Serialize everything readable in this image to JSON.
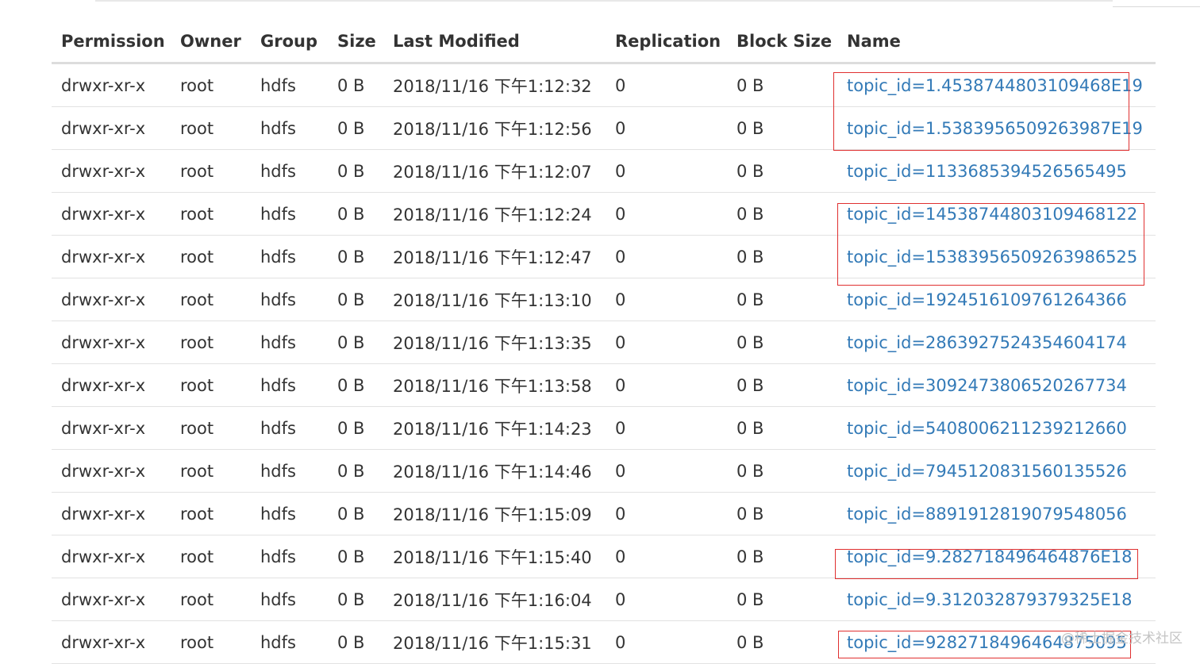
{
  "table": {
    "headers": [
      "Permission",
      "Owner",
      "Group",
      "Size",
      "Last Modified",
      "Replication",
      "Block Size",
      "Name"
    ],
    "rows": [
      {
        "permission": "drwxr-xr-x",
        "owner": "root",
        "group": "hdfs",
        "size": "0 B",
        "modified": "2018/11/16 下午1:12:32",
        "replication": "0",
        "block_size": "0 B",
        "name": "topic_id=1.4538744803109468E19"
      },
      {
        "permission": "drwxr-xr-x",
        "owner": "root",
        "group": "hdfs",
        "size": "0 B",
        "modified": "2018/11/16 下午1:12:56",
        "replication": "0",
        "block_size": "0 B",
        "name": "topic_id=1.5383956509263987E19"
      },
      {
        "permission": "drwxr-xr-x",
        "owner": "root",
        "group": "hdfs",
        "size": "0 B",
        "modified": "2018/11/16 下午1:12:07",
        "replication": "0",
        "block_size": "0 B",
        "name": "topic_id=1133685394526565495"
      },
      {
        "permission": "drwxr-xr-x",
        "owner": "root",
        "group": "hdfs",
        "size": "0 B",
        "modified": "2018/11/16 下午1:12:24",
        "replication": "0",
        "block_size": "0 B",
        "name": "topic_id=14538744803109468122"
      },
      {
        "permission": "drwxr-xr-x",
        "owner": "root",
        "group": "hdfs",
        "size": "0 B",
        "modified": "2018/11/16 下午1:12:47",
        "replication": "0",
        "block_size": "0 B",
        "name": "topic_id=15383956509263986525"
      },
      {
        "permission": "drwxr-xr-x",
        "owner": "root",
        "group": "hdfs",
        "size": "0 B",
        "modified": "2018/11/16 下午1:13:10",
        "replication": "0",
        "block_size": "0 B",
        "name": "topic_id=1924516109761264366"
      },
      {
        "permission": "drwxr-xr-x",
        "owner": "root",
        "group": "hdfs",
        "size": "0 B",
        "modified": "2018/11/16 下午1:13:35",
        "replication": "0",
        "block_size": "0 B",
        "name": "topic_id=2863927524354604174"
      },
      {
        "permission": "drwxr-xr-x",
        "owner": "root",
        "group": "hdfs",
        "size": "0 B",
        "modified": "2018/11/16 下午1:13:58",
        "replication": "0",
        "block_size": "0 B",
        "name": "topic_id=3092473806520267734"
      },
      {
        "permission": "drwxr-xr-x",
        "owner": "root",
        "group": "hdfs",
        "size": "0 B",
        "modified": "2018/11/16 下午1:14:23",
        "replication": "0",
        "block_size": "0 B",
        "name": "topic_id=5408006211239212660"
      },
      {
        "permission": "drwxr-xr-x",
        "owner": "root",
        "group": "hdfs",
        "size": "0 B",
        "modified": "2018/11/16 下午1:14:46",
        "replication": "0",
        "block_size": "0 B",
        "name": "topic_id=7945120831560135526"
      },
      {
        "permission": "drwxr-xr-x",
        "owner": "root",
        "group": "hdfs",
        "size": "0 B",
        "modified": "2018/11/16 下午1:15:09",
        "replication": "0",
        "block_size": "0 B",
        "name": "topic_id=8891912819079548056"
      },
      {
        "permission": "drwxr-xr-x",
        "owner": "root",
        "group": "hdfs",
        "size": "0 B",
        "modified": "2018/11/16 下午1:15:40",
        "replication": "0",
        "block_size": "0 B",
        "name": "topic_id=9.282718496464876E18"
      },
      {
        "permission": "drwxr-xr-x",
        "owner": "root",
        "group": "hdfs",
        "size": "0 B",
        "modified": "2018/11/16 下午1:16:04",
        "replication": "0",
        "block_size": "0 B",
        "name": "topic_id=9.312032879379325E18"
      },
      {
        "permission": "drwxr-xr-x",
        "owner": "root",
        "group": "hdfs",
        "size": "0 B",
        "modified": "2018/11/16 下午1:15:31",
        "replication": "0",
        "block_size": "0 B",
        "name": "topic_id=9282718496464875095"
      }
    ]
  },
  "colors": {
    "link": "#337ab7",
    "highlight_box": "#e03030",
    "text": "#333333"
  },
  "watermark": "@稀土掘金技术社区"
}
